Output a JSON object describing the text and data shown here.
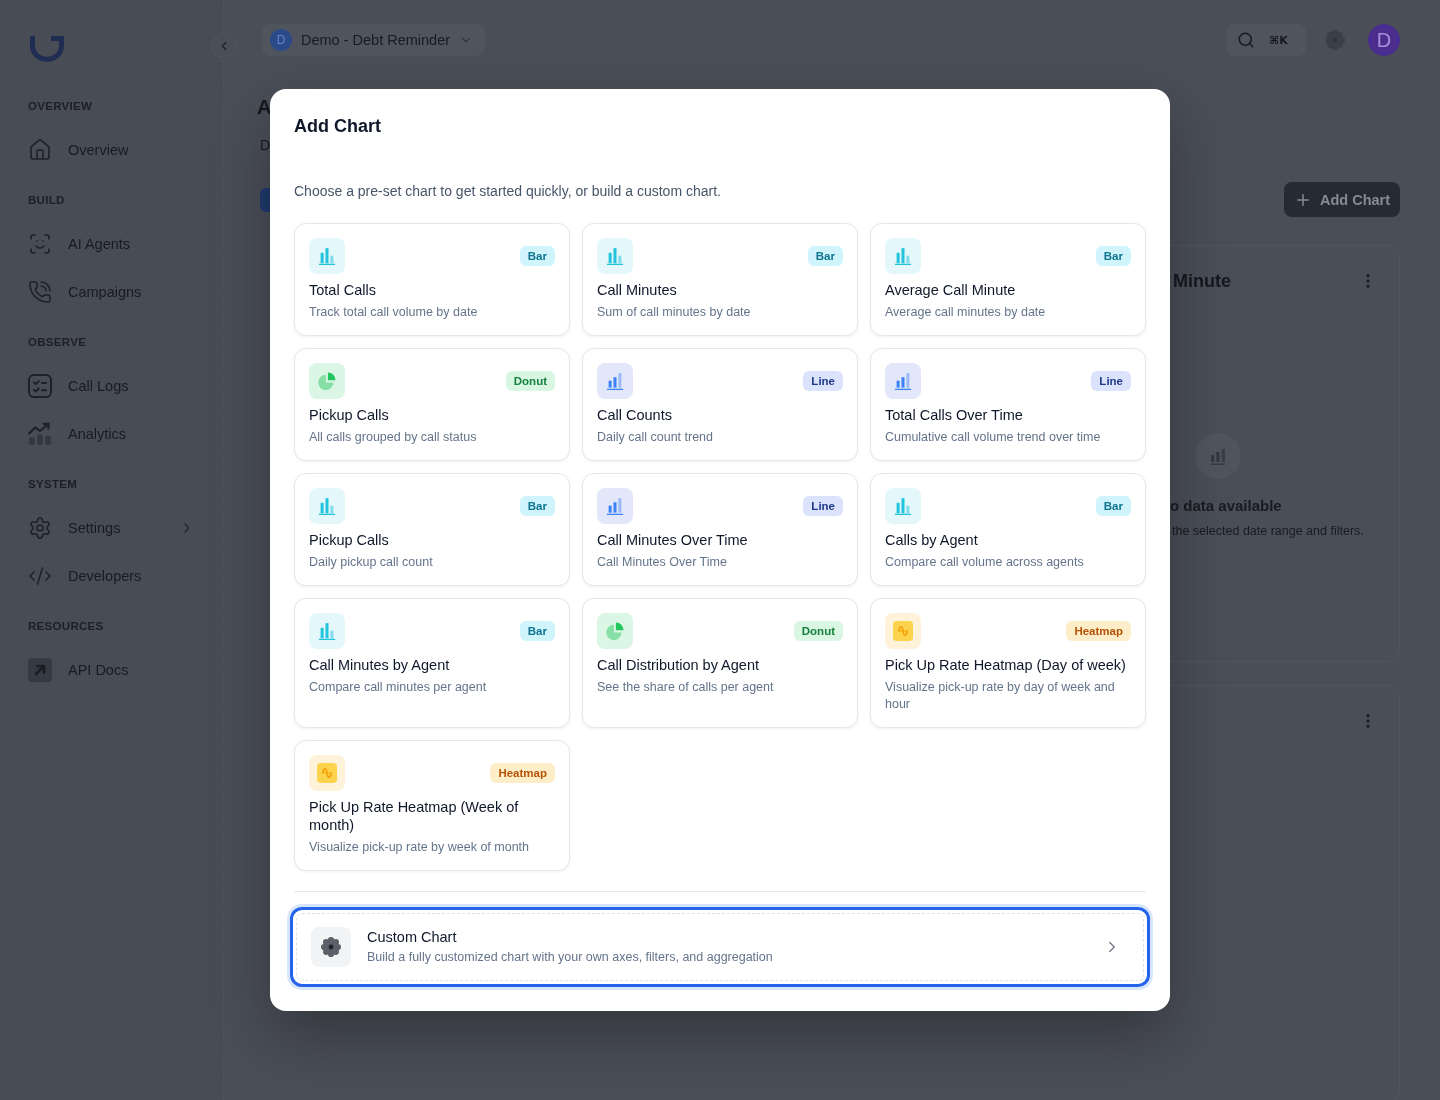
{
  "sidebar": {
    "sections": [
      {
        "title": "OVERVIEW",
        "items": [
          {
            "label": "Overview",
            "kind": "link"
          }
        ]
      },
      {
        "title": "BUILD",
        "items": [
          {
            "label": "AI Agents",
            "kind": "link"
          },
          {
            "label": "Campaigns",
            "kind": "link"
          }
        ]
      },
      {
        "title": "OBSERVE",
        "items": [
          {
            "label": "Call Logs",
            "kind": "link"
          },
          {
            "label": "Analytics",
            "kind": "link"
          }
        ]
      },
      {
        "title": "SYSTEM",
        "items": [
          {
            "label": "Settings",
            "kind": "submenu"
          },
          {
            "label": "Developers",
            "kind": "link"
          }
        ]
      },
      {
        "title": "RESOURCES",
        "items": [
          {
            "label": "API Docs",
            "kind": "link"
          }
        ]
      }
    ]
  },
  "top_bar": {
    "workspace": {
      "initial": "D",
      "name": "Demo - Debt Reminder"
    },
    "search_shortcut": "⌘K",
    "user_initial": "D"
  },
  "page": {
    "title": "A",
    "subtitle": "D",
    "add_chart_button": "Add Chart"
  },
  "dashboard_card": {
    "title": "Minute",
    "empty_title": "o data available",
    "empty_text": "the selected date range and filters."
  },
  "modal": {
    "title": "Add Chart",
    "description": "Choose a pre-set chart to get started quickly, or build a custom chart.",
    "charts": [
      {
        "kind": "bar",
        "badge": "Bar",
        "title": "Total Calls",
        "description": "Track total call volume by date"
      },
      {
        "kind": "bar",
        "badge": "Bar",
        "title": "Call Minutes",
        "description": "Sum of call minutes by date"
      },
      {
        "kind": "bar",
        "badge": "Bar",
        "title": "Average Call Minute",
        "description": "Average call minutes by date"
      },
      {
        "kind": "donut",
        "badge": "Donut",
        "title": "Pickup Calls",
        "description": "All calls grouped by call status"
      },
      {
        "kind": "line",
        "badge": "Line",
        "title": "Call Counts",
        "description": "Daily call count trend"
      },
      {
        "kind": "line",
        "badge": "Line",
        "title": "Total Calls Over Time",
        "description": "Cumulative call volume trend over time"
      },
      {
        "kind": "bar",
        "badge": "Bar",
        "title": "Pickup Calls",
        "description": "Daily pickup call count"
      },
      {
        "kind": "line",
        "badge": "Line",
        "title": "Call Minutes Over Time",
        "description": "Call Minutes Over Time"
      },
      {
        "kind": "bar",
        "badge": "Bar",
        "title": "Calls by Agent",
        "description": "Compare call volume across agents"
      },
      {
        "kind": "bar",
        "badge": "Bar",
        "title": "Call Minutes by Agent",
        "description": "Compare call minutes per agent"
      },
      {
        "kind": "donut",
        "badge": "Donut",
        "title": "Call Distribution by Agent",
        "description": "See the share of calls per agent"
      },
      {
        "kind": "heatmap",
        "badge": "Heatmap",
        "title": "Pick Up Rate Heatmap (Day of week)",
        "description": "Visualize pick-up rate by day of week and hour"
      },
      {
        "kind": "heatmap",
        "badge": "Heatmap",
        "title": "Pick Up Rate Heatmap (Week of month)",
        "description": "Visualize pick-up rate by week of month"
      }
    ],
    "custom_chart": {
      "title": "Custom Chart",
      "description": "Build a fully customized chart with your own axes, filters, and aggregation",
      "focused": true
    }
  }
}
